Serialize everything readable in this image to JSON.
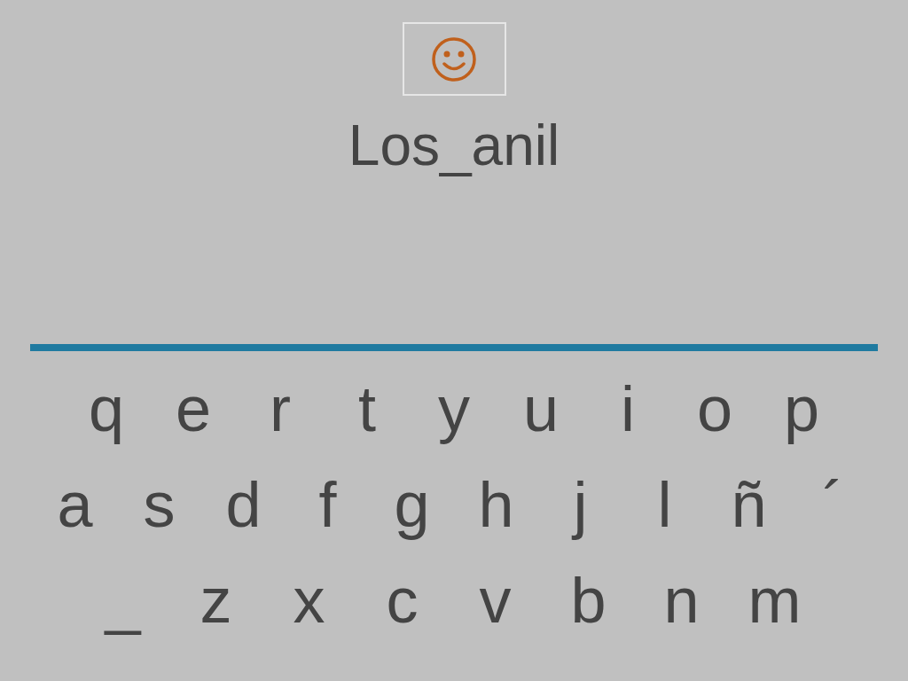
{
  "word": "Los_anil",
  "keyboard": {
    "rows": [
      [
        "q",
        "e",
        "r",
        "t",
        "y",
        "u",
        "i",
        "o",
        "p"
      ],
      [
        "a",
        "s",
        "d",
        "f",
        "g",
        "h",
        "j",
        "l",
        "ñ",
        "´"
      ],
      [
        "_",
        "z",
        "x",
        "c",
        "v",
        "b",
        "n",
        "m"
      ]
    ]
  }
}
